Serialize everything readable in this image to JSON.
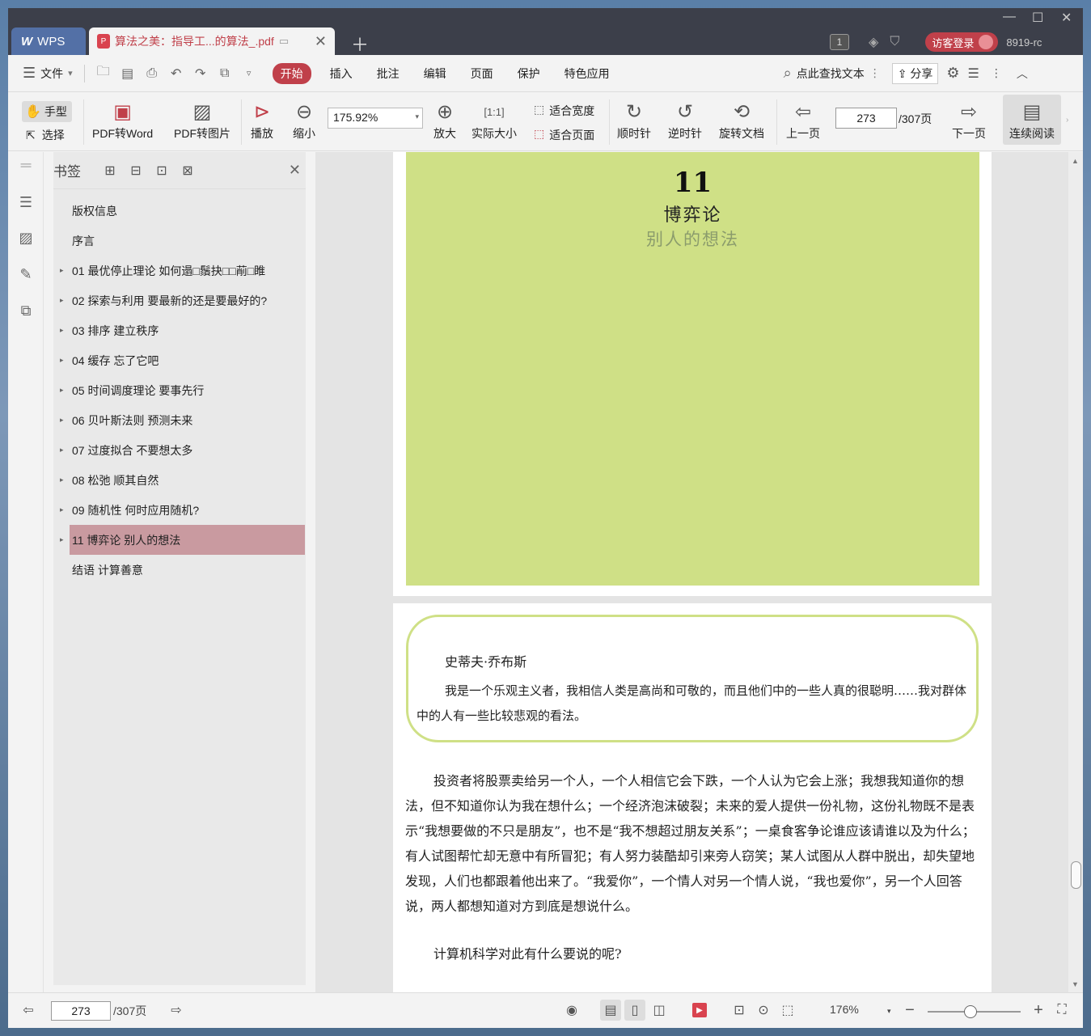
{
  "titlebar": {
    "app_tab": "WPS",
    "doc_tab": "算法之美：指导工...的算法_.pdf",
    "user_count": "1",
    "login_label": "访客登录",
    "version": "8919-rc"
  },
  "menubar": {
    "file_label": "文件",
    "tabs": [
      "开始",
      "插入",
      "批注",
      "编辑",
      "页面",
      "保护",
      "特色应用"
    ],
    "search_placeholder": "点此查找文本",
    "share_label": "分享"
  },
  "toolbar": {
    "hand_label": "手型",
    "select_label": "选择",
    "pdf_to_word": "PDF转Word",
    "pdf_to_image": "PDF转图片",
    "play": "播放",
    "zoom_out": "缩小",
    "zoom_value": "175.92%",
    "zoom_in": "放大",
    "actual_size": "实际大小",
    "fit_width": "适合宽度",
    "fit_page": "适合页面",
    "clockwise": "顺时针",
    "counterclockwise": "逆时针",
    "rotate_doc": "旋转文档",
    "prev_page": "上一页",
    "page_current": "273",
    "page_total": "/307页",
    "next_page": "下一页",
    "continuous": "连续阅读"
  },
  "bookmarks": {
    "title": "书签",
    "items": [
      {
        "label": "版权信息",
        "expandable": false
      },
      {
        "label": "序言",
        "expandable": false
      },
      {
        "label": "01 最优停止理论 如何遢□鬚抉□□萷□睢",
        "expandable": true
      },
      {
        "label": "02 探索与利用 要最新的还是要最好的?",
        "expandable": true
      },
      {
        "label": "03 排序 建立秩序",
        "expandable": true
      },
      {
        "label": "04 缓存 忘了它吧",
        "expandable": true
      },
      {
        "label": "05 时间调度理论 要事先行",
        "expandable": true
      },
      {
        "label": "06 贝叶斯法则 预测未来",
        "expandable": true
      },
      {
        "label": "07 过度拟合 不要想太多",
        "expandable": true
      },
      {
        "label": "08 松弛 顺其自然",
        "expandable": true
      },
      {
        "label": "09 随机性 何时应用随机?",
        "expandable": true
      },
      {
        "label": "11 博弈论 别人的想法",
        "expandable": true,
        "selected": true
      },
      {
        "label": "结语 计算善意",
        "expandable": false
      }
    ]
  },
  "document": {
    "chapter_number": "11",
    "chapter_title": "博弈论",
    "chapter_subtitle": "别人的想法",
    "quote_author": "史蒂夫·乔布斯",
    "quote_text": "我是一个乐观主义者，我相信人类是高尚和可敬的，而且他们中的一些人真的很聪明……我对群体中的人有一些比较悲观的看法。",
    "paragraph1": "投资者将股票卖给另一个人，一个人相信它会下跌，一个人认为它会上涨；我想我知道你的想法，但不知道你认为我在想什么；一个经济泡沫破裂；未来的爱人提供一份礼物，这份礼物既不是表示“我想要做的不只是朋友”，也不是“我不想超过朋友关系”；一桌食客争论谁应该请谁以及为什么；有人试图帮忙却无意中有所冒犯；有人努力装酷却引来旁人窃笑；某人试图从人群中脱出，却失望地发现，人们也都跟着他出来了。“我爱你”，一个情人对另一个情人说，“我也爱你”，另一个人回答说，两人都想知道对方到底是想说什么。",
    "paragraph2": "计算机科学对此有什么要说的呢?"
  },
  "statusbar": {
    "page_current": "273",
    "page_total": "/307页",
    "zoom": "176%",
    "zoom_slider_fraction": 0.45
  }
}
